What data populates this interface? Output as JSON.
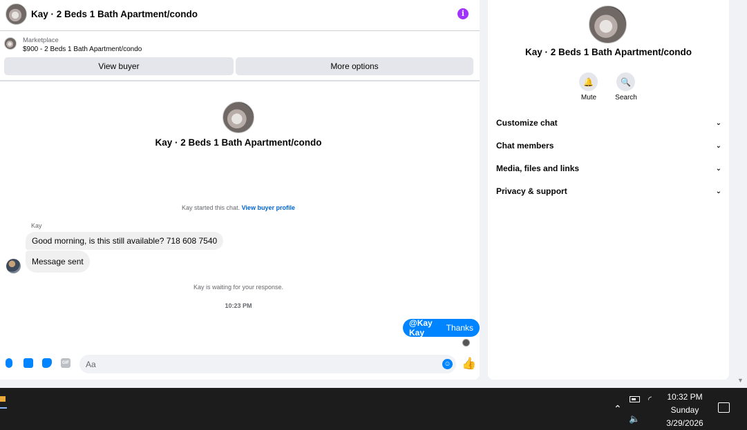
{
  "chat": {
    "header_title": "Kay · 2 Beds 1 Bath Apartment/condo",
    "info_icon": "info-icon",
    "marketplace_label": "Marketplace",
    "listing": "$900 - 2 Beds 1 Bath Apartment/condo",
    "view_buyer": "View buyer",
    "more_options": "More options",
    "intro_title": "Kay · 2 Beds 1 Bath Apartment/condo",
    "started_text": "Kay started this chat.",
    "view_profile": "View buyer profile",
    "sender": "Kay",
    "messages": [
      "Good morning, is this still available? 718 608 7540",
      "Message sent"
    ],
    "waiting": "Kay is waiting for your response.",
    "time": "10:23 PM",
    "outgoing_mention": "@Kay Kay",
    "outgoing_text": "Thanks",
    "input_placeholder": "Aa",
    "composer_icons": [
      "microphone-icon",
      "image-icon",
      "sticker-icon",
      "gif-icon",
      "emoji-icon",
      "thumbs-up-icon"
    ],
    "accent_color": "#0084ff"
  },
  "info": {
    "title": "Kay · 2 Beds 1 Bath Apartment/condo",
    "mute": "Mute",
    "search": "Search",
    "sections": [
      "Customize chat",
      "Chat members",
      "Media, files and links",
      "Privacy & support"
    ]
  },
  "taskbar": {
    "time": "10:32 PM",
    "day": "Sunday",
    "date": "3/29/2026",
    "tray_icons": [
      "chevron-up-icon",
      "battery-icon",
      "wifi-icon",
      "volume-icon",
      "notification-icon"
    ]
  }
}
